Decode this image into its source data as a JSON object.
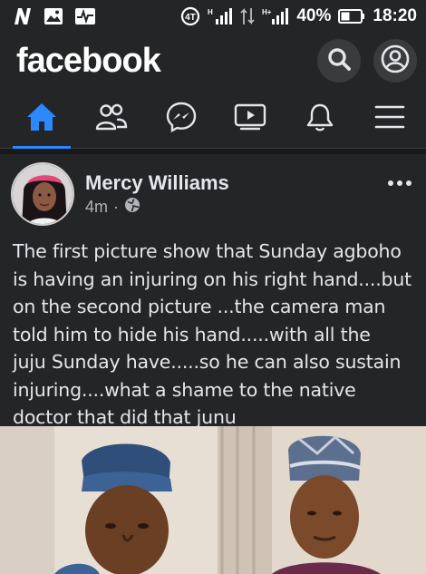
{
  "status_bar": {
    "battery": "40%",
    "time": "18:20",
    "icons": [
      "notification-n-icon",
      "gallery-icon",
      "activity-icon",
      "data-saver-icon",
      "signal-h-icon",
      "data-arrows-icon",
      "signal-h-plus-icon",
      "battery-icon"
    ]
  },
  "app": {
    "logo": "facebook",
    "actions": [
      "search-icon",
      "profile-icon"
    ]
  },
  "nav": {
    "tabs": [
      {
        "name": "home",
        "icon": "home-icon",
        "active": true
      },
      {
        "name": "friends",
        "icon": "friends-icon",
        "active": false
      },
      {
        "name": "messenger",
        "icon": "messenger-icon",
        "active": false
      },
      {
        "name": "watch",
        "icon": "watch-icon",
        "active": false
      },
      {
        "name": "notifications",
        "icon": "bell-icon",
        "active": false
      },
      {
        "name": "menu",
        "icon": "menu-icon",
        "active": false
      }
    ]
  },
  "post": {
    "author": "Mercy Williams",
    "time": "4m",
    "separator": "·",
    "privacy_icon": "globe-icon",
    "text_lines": [
      "The first picture show that Sunday agboho",
      "is having an injuring on his right hand....but",
      "on the second picture ...the camera man",
      "told him to hide his hand.....with all the",
      "juju Sunday have.....so he can also sustain",
      "injuring....what a shame to the native",
      "doctor that did that junu"
    ]
  },
  "colors": {
    "background": "#18191a",
    "surface": "#242526",
    "accent": "#2d88ff",
    "text": "#e4e6eb",
    "secondary_text": "#b0b3b8"
  }
}
